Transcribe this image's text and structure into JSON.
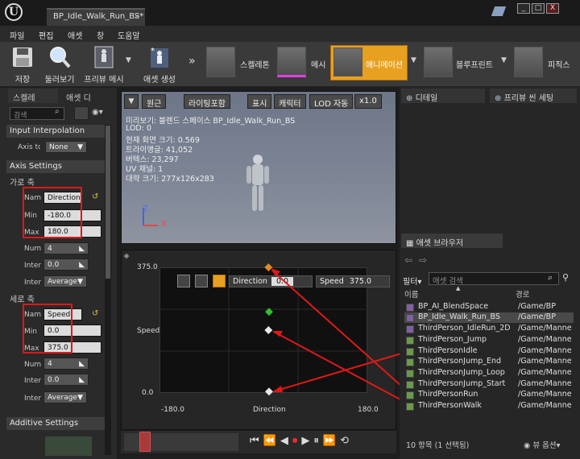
{
  "window": {
    "logo": "U",
    "tab_title": "BP_Idle_Walk_Run_BS*",
    "tab_close": "×",
    "minimize": "_",
    "maximize": "□",
    "close": "X"
  },
  "menu": [
    "파일",
    "편집",
    "애셋",
    "창",
    "도움말"
  ],
  "toolbar": {
    "save": "저장",
    "browse": "둘러보기",
    "preview_mesh": "프리뷰 메시",
    "create_asset": "애셋 생성",
    "modes": [
      "스켈레톤",
      "메시",
      "애니메이션",
      "블루프린트",
      "피직스"
    ],
    "overflow": "»"
  },
  "left_panel": {
    "tabs": [
      "스켈레",
      "애셋 디"
    ],
    "search_placeholder": "검색",
    "input_interpolation": "Input Interpolation",
    "axis_to_scale": "Axis to",
    "axis_to_scale_value": "None",
    "axis_settings": "Axis Settings",
    "horizontal": "가로 축",
    "vertical": "세로 축",
    "name_label": "Nam",
    "min_label": "Min",
    "max_label": "Max",
    "num_label": "Num",
    "inter_label": "Inter",
    "inter2_label": "Inter",
    "h_name": "Direction",
    "h_min": "-180.0",
    "h_max": "180.0",
    "h_num": "4",
    "h_inter": "0.0",
    "h_interp": "Average",
    "v_name": "Speed",
    "v_min": "0.0",
    "v_max": "375.0",
    "v_num": "4",
    "v_inter": "0.0",
    "v_interp": "Average",
    "additive_settings": "Additive Settings"
  },
  "viewport": {
    "buttons": [
      "원근",
      "라이팅포함",
      "표시",
      "캐릭터",
      "LOD 자동",
      "x1.0"
    ],
    "stats": [
      "미리보기: 블렌드 스페이스 BP_Idle_Walk_Run_BS",
      "LOD: 0",
      "현재 화면 크기: 0.569",
      "트라이앵글: 41,052",
      "버텍스: 23,297",
      "UV 채널: 1",
      "대략 크기: 277x126x283"
    ],
    "axis_x": "X",
    "axis_z": "Z"
  },
  "blend_space": {
    "y_max": "375.0",
    "y_min": "0.0",
    "y_label": "Speed",
    "x_min": "-180.0",
    "x_max": "180.0",
    "x_label": "Direction",
    "direction_label": "Direction",
    "direction_value": "0.0",
    "speed_label": "Speed",
    "speed_value": "375.0"
  },
  "right_panel": {
    "details_tab": "디테일",
    "preview_tab": "프리뷰 씬 세팅",
    "asset_browser_tab": "애셋 브라우저",
    "filter": "필터",
    "search_placeholder": "애셋 검색",
    "col_name": "이름",
    "col_path": "경로",
    "assets": [
      {
        "name": "BP_AI_BlendSpace",
        "path": "/Game/BP"
      },
      {
        "name": "BP_Idle_Walk_Run_BS",
        "path": "/Game/BP"
      },
      {
        "name": "ThirdPerson_IdleRun_2D",
        "path": "/Game/Manne"
      },
      {
        "name": "ThirdPerson_Jump",
        "path": "/Game/Manne"
      },
      {
        "name": "ThirdPersonIdle",
        "path": "/Game/Manne"
      },
      {
        "name": "ThirdPersonJump_End",
        "path": "/Game/Manne"
      },
      {
        "name": "ThirdPersonJump_Loop",
        "path": "/Game/Manne"
      },
      {
        "name": "ThirdPersonJump_Start",
        "path": "/Game/Manne"
      },
      {
        "name": "ThirdPersonRun",
        "path": "/Game/Manne"
      },
      {
        "name": "ThirdPersonWalk",
        "path": "/Game/Manne"
      }
    ],
    "status": "10 항목 (1 선택됨)",
    "view_options": "뷰 옵션"
  },
  "colors": {
    "accent_orange": "#e8a020",
    "annotation_red": "#e01818",
    "selected_row": "#4a4a4a"
  }
}
